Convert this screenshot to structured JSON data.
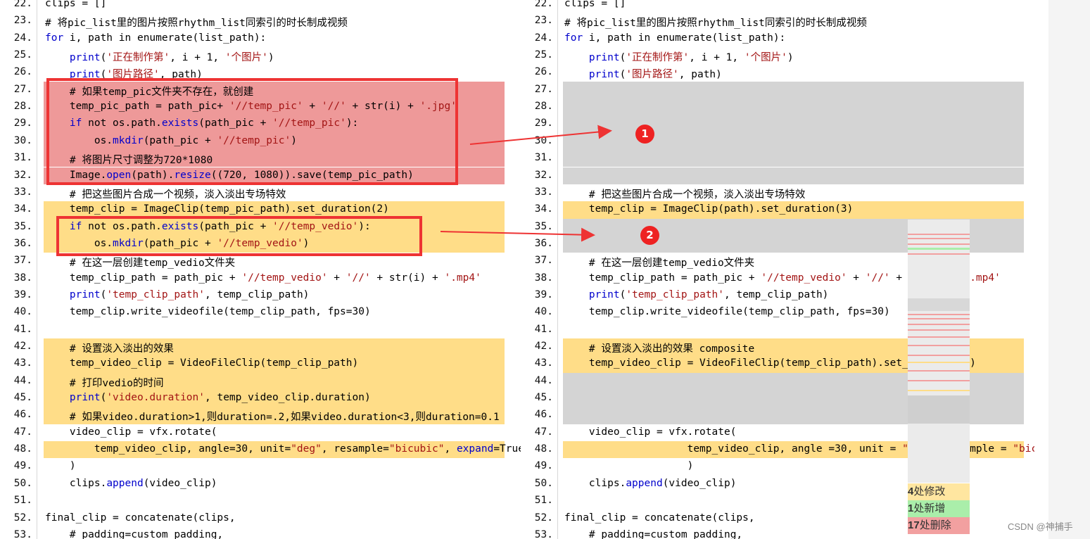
{
  "colors": {
    "deleted": "#ee9999",
    "modified": "#ffdd88",
    "removed_gray": "#d4d4d4",
    "keyword": "#0000cc",
    "string": "#a31515",
    "annotation": "#ee3333"
  },
  "left": {
    "lines": [
      {
        "n": "22.",
        "hl": "none",
        "code": [
          {
            "t": "clips = []"
          }
        ]
      },
      {
        "n": "23.",
        "hl": "none",
        "code": [
          {
            "t": "# 将pic_list里的图片按照rhythm_list同索引的时长制成视频"
          }
        ]
      },
      {
        "n": "24.",
        "hl": "none",
        "code": [
          {
            "t": "for",
            "c": "kw"
          },
          {
            "t": " i, path in enumerate(list_path):"
          }
        ]
      },
      {
        "n": "25.",
        "hl": "none",
        "code": [
          {
            "t": "    "
          },
          {
            "t": "print",
            "c": "kw"
          },
          {
            "t": "("
          },
          {
            "t": "'正在制作第'",
            "c": "str"
          },
          {
            "t": ", i + 1, "
          },
          {
            "t": "'个图片'",
            "c": "str"
          },
          {
            "t": ")"
          }
        ]
      },
      {
        "n": "26.",
        "hl": "none",
        "code": [
          {
            "t": "    "
          },
          {
            "t": "print",
            "c": "kw"
          },
          {
            "t": "("
          },
          {
            "t": "'图片路径'",
            "c": "str"
          },
          {
            "t": ", path)"
          }
        ]
      },
      {
        "n": "27.",
        "hl": "red",
        "code": [
          {
            "t": "    # 如果temp_pic文件夹不存在，就创建"
          }
        ]
      },
      {
        "n": "28.",
        "hl": "red",
        "code": [
          {
            "t": "    temp_pic_path = path_pic+ "
          },
          {
            "t": "'//temp_pic'",
            "c": "str"
          },
          {
            "t": " + "
          },
          {
            "t": "'//'",
            "c": "str"
          },
          {
            "t": " + str(i) + "
          },
          {
            "t": "'.jpg'",
            "c": "str"
          }
        ]
      },
      {
        "n": "29.",
        "hl": "red",
        "code": [
          {
            "t": "    "
          },
          {
            "t": "if",
            "c": "kw"
          },
          {
            "t": " not os.path."
          },
          {
            "t": "exists",
            "c": "kw"
          },
          {
            "t": "(path_pic + "
          },
          {
            "t": "'//temp_pic'",
            "c": "str"
          },
          {
            "t": "):"
          }
        ]
      },
      {
        "n": "30.",
        "hl": "red",
        "code": [
          {
            "t": "        os."
          },
          {
            "t": "mkdir",
            "c": "kw"
          },
          {
            "t": "(path_pic + "
          },
          {
            "t": "'//temp_pic'",
            "c": "str"
          },
          {
            "t": ")"
          }
        ]
      },
      {
        "n": "31.",
        "hl": "red",
        "code": [
          {
            "t": "    # 将图片尺寸调整为720*1080"
          }
        ]
      },
      {
        "n": "32.",
        "hl": "red",
        "code": [
          {
            "t": "    Image."
          },
          {
            "t": "open",
            "c": "kw"
          },
          {
            "t": "(path)."
          },
          {
            "t": "resize",
            "c": "kw"
          },
          {
            "t": "((720, 1080)).save(temp_pic_path)"
          }
        ]
      },
      {
        "n": "33.",
        "hl": "none",
        "code": [
          {
            "t": "    # 把这些图片合成一个视频，淡入淡出专场特效"
          }
        ]
      },
      {
        "n": "34.",
        "hl": "yellow",
        "code": [
          {
            "t": "    temp_clip = ImageClip(temp_pic_path).set_duration(2)"
          }
        ]
      },
      {
        "n": "35.",
        "hl": "yellow",
        "code": [
          {
            "t": "    "
          },
          {
            "t": "if",
            "c": "kw"
          },
          {
            "t": " not os.path."
          },
          {
            "t": "exists",
            "c": "kw"
          },
          {
            "t": "(path_pic + "
          },
          {
            "t": "'//temp_vedio'",
            "c": "str"
          },
          {
            "t": "):"
          }
        ]
      },
      {
        "n": "36.",
        "hl": "yellow",
        "code": [
          {
            "t": "        os."
          },
          {
            "t": "mkdir",
            "c": "kw"
          },
          {
            "t": "(path_pic + "
          },
          {
            "t": "'//temp_vedio'",
            "c": "str"
          },
          {
            "t": ")"
          }
        ]
      },
      {
        "n": "37.",
        "hl": "none",
        "code": [
          {
            "t": "    # 在这一层创建temp_vedio文件夹"
          }
        ]
      },
      {
        "n": "38.",
        "hl": "none",
        "code": [
          {
            "t": "    temp_clip_path = path_pic + "
          },
          {
            "t": "'//temp_vedio'",
            "c": "str"
          },
          {
            "t": " + "
          },
          {
            "t": "'//'",
            "c": "str"
          },
          {
            "t": " + str(i) + "
          },
          {
            "t": "'.mp4'",
            "c": "str"
          }
        ]
      },
      {
        "n": "39.",
        "hl": "none",
        "code": [
          {
            "t": "    "
          },
          {
            "t": "print",
            "c": "kw"
          },
          {
            "t": "("
          },
          {
            "t": "'temp_clip_path'",
            "c": "str"
          },
          {
            "t": ", temp_clip_path)"
          }
        ]
      },
      {
        "n": "40.",
        "hl": "none",
        "code": [
          {
            "t": "    temp_clip.write_videofile(temp_clip_path, fps=30)"
          }
        ]
      },
      {
        "n": "41.",
        "hl": "none",
        "code": [
          {
            "t": ""
          }
        ]
      },
      {
        "n": "42.",
        "hl": "yellow",
        "code": [
          {
            "t": "    # 设置淡入淡出的效果"
          }
        ]
      },
      {
        "n": "43.",
        "hl": "yellow",
        "code": [
          {
            "t": "    temp_video_clip = VideoFileClip(temp_clip_path)"
          }
        ]
      },
      {
        "n": "44.",
        "hl": "yellow",
        "code": [
          {
            "t": "    # 打印vedio的时间"
          }
        ]
      },
      {
        "n": "45.",
        "hl": "yellow",
        "code": [
          {
            "t": "    "
          },
          {
            "t": "print",
            "c": "kw"
          },
          {
            "t": "("
          },
          {
            "t": "'video.duration'",
            "c": "str"
          },
          {
            "t": ", temp_video_clip.duration)"
          }
        ]
      },
      {
        "n": "46.",
        "hl": "yellow",
        "code": [
          {
            "t": "    # 如果video.duration>1,则duration=.2,如果video.duration<3,则duration=0.1"
          }
        ]
      },
      {
        "n": "47.",
        "hl": "none",
        "code": [
          {
            "t": "    video_clip = vfx.rotate("
          }
        ]
      },
      {
        "n": "48.",
        "hl": "yellow",
        "code": [
          {
            "t": "        temp_video_clip, angle=30, unit="
          },
          {
            "t": "\"deg\"",
            "c": "str"
          },
          {
            "t": ", resample="
          },
          {
            "t": "\"bicubic\"",
            "c": "str"
          },
          {
            "t": ", "
          },
          {
            "t": "expand",
            "c": "kw"
          },
          {
            "t": "=True"
          }
        ]
      },
      {
        "n": "49.",
        "hl": "none",
        "code": [
          {
            "t": "    )"
          }
        ]
      },
      {
        "n": "50.",
        "hl": "none",
        "code": [
          {
            "t": "    clips."
          },
          {
            "t": "append",
            "c": "kw"
          },
          {
            "t": "(video_clip)"
          }
        ]
      },
      {
        "n": "51.",
        "hl": "none",
        "code": [
          {
            "t": ""
          }
        ]
      },
      {
        "n": "52.",
        "hl": "none",
        "code": [
          {
            "t": "final_clip = concatenate(clips,"
          }
        ]
      },
      {
        "n": "53.",
        "hl": "none",
        "code": [
          {
            "t": "    # padding=custom_padding,"
          }
        ]
      }
    ]
  },
  "right": {
    "lines": [
      {
        "n": "22.",
        "hl": "none",
        "code": [
          {
            "t": "clips = []"
          }
        ]
      },
      {
        "n": "23.",
        "hl": "none",
        "code": [
          {
            "t": "# 将pic_list里的图片按照rhythm_list同索引的时长制成视频"
          }
        ]
      },
      {
        "n": "24.",
        "hl": "none",
        "code": [
          {
            "t": "for",
            "c": "kw"
          },
          {
            "t": " i, path in enumerate(list_path):"
          }
        ]
      },
      {
        "n": "25.",
        "hl": "none",
        "code": [
          {
            "t": "    "
          },
          {
            "t": "print",
            "c": "kw"
          },
          {
            "t": "("
          },
          {
            "t": "'正在制作第'",
            "c": "str"
          },
          {
            "t": ", i + 1, "
          },
          {
            "t": "'个图片'",
            "c": "str"
          },
          {
            "t": ")"
          }
        ]
      },
      {
        "n": "26.",
        "hl": "none",
        "code": [
          {
            "t": "    "
          },
          {
            "t": "print",
            "c": "kw"
          },
          {
            "t": "("
          },
          {
            "t": "'图片路径'",
            "c": "str"
          },
          {
            "t": ", path)"
          }
        ]
      },
      {
        "n": "27.",
        "hl": "gray",
        "code": []
      },
      {
        "n": "28.",
        "hl": "gray",
        "code": []
      },
      {
        "n": "29.",
        "hl": "gray",
        "code": []
      },
      {
        "n": "30.",
        "hl": "gray",
        "code": []
      },
      {
        "n": "31.",
        "hl": "gray",
        "code": []
      },
      {
        "n": "32.",
        "hl": "gray",
        "code": []
      },
      {
        "n": "33.",
        "hl": "none",
        "code": [
          {
            "t": "    # 把这些图片合成一个视频，淡入淡出专场特效"
          }
        ]
      },
      {
        "n": "34.",
        "hl": "yellow",
        "code": [
          {
            "t": "    temp_clip = ImageClip(path).set_duration(3)"
          }
        ]
      },
      {
        "n": "35.",
        "hl": "gray",
        "code": []
      },
      {
        "n": "36.",
        "hl": "gray",
        "code": []
      },
      {
        "n": "37.",
        "hl": "none",
        "code": [
          {
            "t": "    # 在这一层创建temp_vedio文件夹"
          }
        ]
      },
      {
        "n": "38.",
        "hl": "none",
        "code": [
          {
            "t": "    temp_clip_path = path_pic + "
          },
          {
            "t": "'//temp_vedio'",
            "c": "str"
          },
          {
            "t": " + "
          },
          {
            "t": "'//'",
            "c": "str"
          },
          {
            "t": " + str(i) + "
          },
          {
            "t": "'.mp4'",
            "c": "str"
          }
        ]
      },
      {
        "n": "39.",
        "hl": "none",
        "code": [
          {
            "t": "    "
          },
          {
            "t": "print",
            "c": "kw"
          },
          {
            "t": "("
          },
          {
            "t": "'temp_clip_path'",
            "c": "str"
          },
          {
            "t": ", temp_clip_path)"
          }
        ]
      },
      {
        "n": "40.",
        "hl": "none",
        "code": [
          {
            "t": "    temp_clip.write_videofile(temp_clip_path, fps=30)"
          }
        ]
      },
      {
        "n": "41.",
        "hl": "none",
        "code": [
          {
            "t": ""
          }
        ]
      },
      {
        "n": "42.",
        "hl": "yellow",
        "code": [
          {
            "t": "    # 设置淡入淡出的效果 composite"
          }
        ]
      },
      {
        "n": "43.",
        "hl": "yellow",
        "code": [
          {
            "t": "    temp_video_clip = VideoFileClip(temp_clip_path).set_opacity(.5)"
          }
        ]
      },
      {
        "n": "44.",
        "hl": "gray",
        "code": []
      },
      {
        "n": "45.",
        "hl": "gray",
        "code": []
      },
      {
        "n": "46.",
        "hl": "gray",
        "code": []
      },
      {
        "n": "47.",
        "hl": "none",
        "code": [
          {
            "t": "    video_clip = vfx.rotate("
          }
        ]
      },
      {
        "n": "48.",
        "hl": "yellow",
        "code": [
          {
            "t": "                    temp_video_clip, angle =30, unit = "
          },
          {
            "t": "\"deg\"",
            "c": "str"
          },
          {
            "t": ", resample = "
          },
          {
            "t": "\"bicubic\"",
            "c": "str"
          }
        ]
      },
      {
        "n": "49.",
        "hl": "none",
        "code": [
          {
            "t": "                    )"
          }
        ]
      },
      {
        "n": "50.",
        "hl": "none",
        "code": [
          {
            "t": "    clips."
          },
          {
            "t": "append",
            "c": "kw"
          },
          {
            "t": "(video_clip)"
          }
        ]
      },
      {
        "n": "51.",
        "hl": "none",
        "code": [
          {
            "t": ""
          }
        ]
      },
      {
        "n": "52.",
        "hl": "none",
        "code": [
          {
            "t": "final_clip = concatenate(clips,"
          }
        ]
      },
      {
        "n": "53.",
        "hl": "none",
        "code": [
          {
            "t": "    # padding=custom_padding,"
          }
        ]
      }
    ]
  },
  "annotations": {
    "badge_1": "1",
    "badge_2": "2"
  },
  "legend": {
    "modified": {
      "count": "4",
      "label": "处修改",
      "color": "#ffe6a0"
    },
    "added": {
      "count": "1",
      "label": "处新增",
      "color": "#aaeeaa"
    },
    "deleted": {
      "count": "17",
      "label": "处删除",
      "color": "#f2a0a0"
    }
  },
  "watermark": "CSDN @神捕手"
}
